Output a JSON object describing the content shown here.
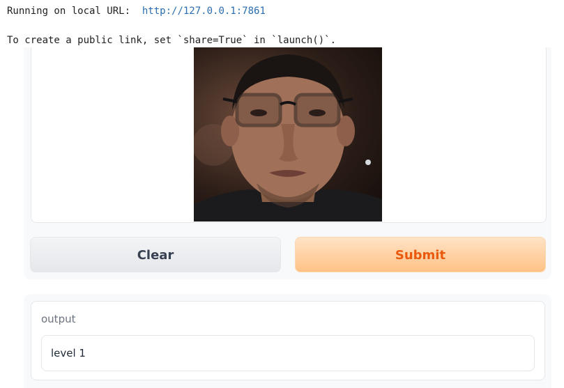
{
  "console": {
    "line1_prefix": "Running on local URL:  ",
    "local_url": "http://127.0.0.1:7861",
    "line2": "To create a public link, set `share=True` in `launch()`."
  },
  "image_input": {
    "image_subject": "portrait-photo"
  },
  "buttons": {
    "clear_label": "Clear",
    "submit_label": "Submit"
  },
  "output": {
    "label": "output",
    "value": "level 1"
  },
  "colors": {
    "accent": "#ea580c",
    "submit_bg": "#ffd2a6",
    "link": "#2a6db0"
  }
}
